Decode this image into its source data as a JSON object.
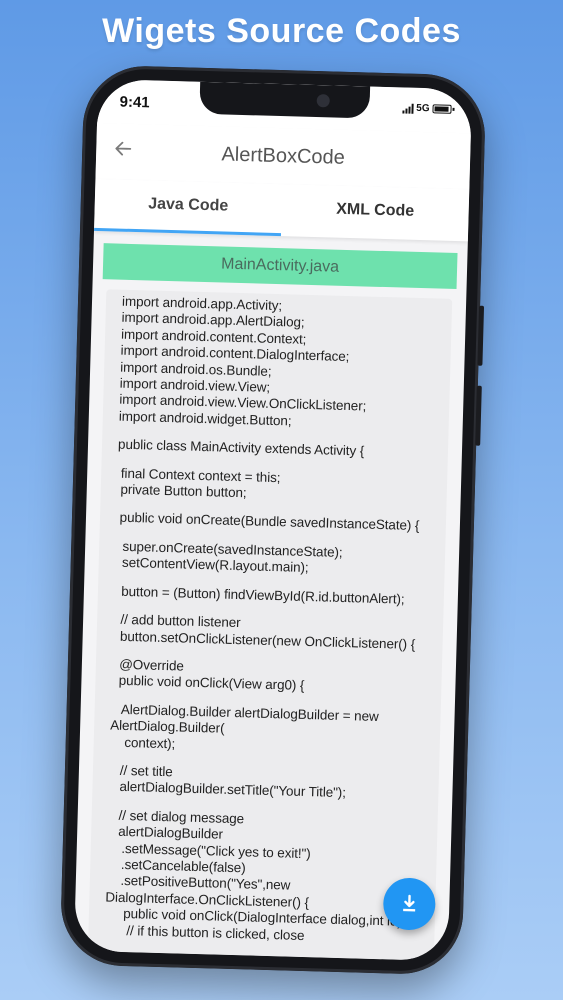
{
  "headline": "Wigets Source Codes",
  "status_bar": {
    "time": "9:41",
    "network": "5G"
  },
  "app_bar": {
    "title": "AlertBoxCode",
    "back_icon": "arrow-left-icon"
  },
  "tabs": [
    {
      "label": "Java Code",
      "active": true
    },
    {
      "label": "XML Code",
      "active": false
    }
  ],
  "file_name": "MainActivity.java",
  "code_lines": [
    "import android.app.Activity;",
    "import android.app.AlertDialog;",
    "import android.content.Context;",
    "import android.content.DialogInterface;",
    "import android.os.Bundle;",
    "import android.view.View;",
    "import android.view.View.OnClickListener;",
    "import android.widget.Button;",
    "",
    "public class MainActivity extends Activity {",
    "",
    " final Context context = this;",
    " private Button button;",
    "",
    " public void onCreate(Bundle savedInstanceState) {",
    "",
    "  super.onCreate(savedInstanceState);",
    "  setContentView(R.layout.main);",
    "",
    "  button = (Button) findViewById(R.id.buttonAlert);",
    "",
    "  // add button listener",
    "  button.setOnClickListener(new OnClickListener() {",
    "",
    "  @Override",
    "  public void onClick(View arg0) {",
    "",
    "   AlertDialog.Builder alertDialogBuilder = new",
    "AlertDialog.Builder(",
    "    context);",
    "",
    "   // set title",
    "   alertDialogBuilder.setTitle(\"Your Title\");",
    "",
    "   // set dialog message",
    "   alertDialogBuilder",
    "    .setMessage(\"Click yes to exit!\")",
    "    .setCancelable(false)",
    "    .setPositiveButton(\"Yes\",new",
    "DialogInterface.OnClickListener() {",
    "     public void onClick(DialogInterface dialog,int id) {",
    "      // if this button is clicked, close"
  ],
  "fab": {
    "icon": "download-icon"
  },
  "colors": {
    "accent": "#42a5f5",
    "banner": "#6ee1ad",
    "fab": "#2196f3"
  }
}
